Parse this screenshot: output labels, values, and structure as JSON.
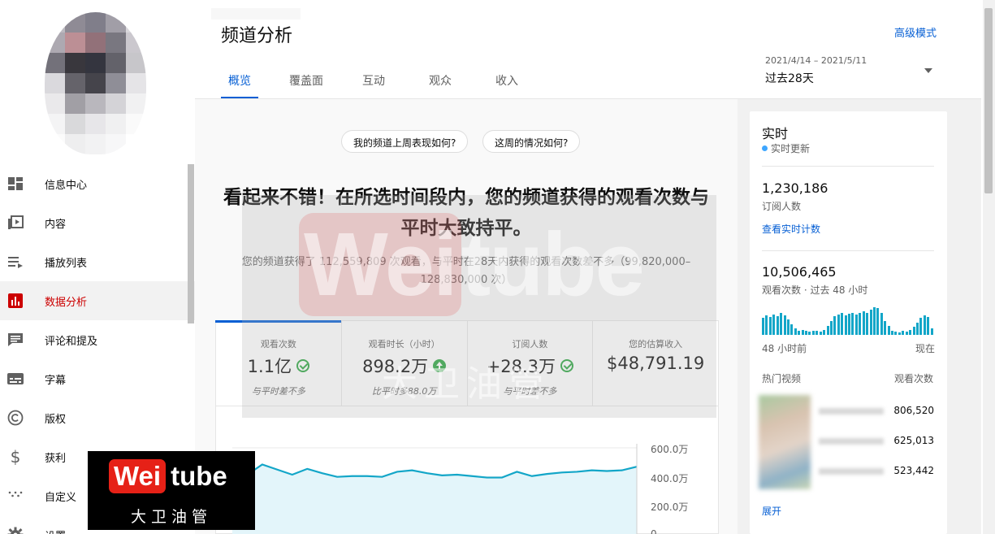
{
  "sidebar": {
    "items": [
      {
        "label": "信息中心",
        "icon": "dashboard-icon"
      },
      {
        "label": "内容",
        "icon": "video-library-icon"
      },
      {
        "label": "播放列表",
        "icon": "playlist-icon"
      },
      {
        "label": "数据分析",
        "icon": "analytics-icon",
        "active": true
      },
      {
        "label": "评论和提及",
        "icon": "comment-icon"
      },
      {
        "label": "字幕",
        "icon": "subtitles-icon"
      },
      {
        "label": "版权",
        "icon": "copyright-icon"
      },
      {
        "label": "获利",
        "icon": "dollar-icon"
      },
      {
        "label": "自定义",
        "icon": "customize-icon"
      },
      {
        "label": "设置",
        "icon": "gear-icon"
      }
    ]
  },
  "header": {
    "title": "频道分析",
    "advanced_mode": "高级模式",
    "tabs": [
      "概览",
      "覆盖面",
      "互动",
      "观众",
      "收入"
    ],
    "date_range": "2021/4/14 – 2021/5/11",
    "period": "过去28天"
  },
  "main": {
    "chips": [
      "我的频道上周表现如何?",
      "这周的情况如何?"
    ],
    "headline": "看起来不错！在所选时间段内，您的频道获得的观看次数与平时大致持平。",
    "subline": "您的频道获得了 112,559,809 次观看，与平时在28天内获得的观看次数差不多（99,820,000–128,830,000 次）",
    "metrics": [
      {
        "label": "观看次数",
        "value": "1.1亿",
        "note": "与平时差不多",
        "status": "ok"
      },
      {
        "label": "观看时长（小时）",
        "value": "898.2万",
        "note": "比平时多88.0万",
        "status": "up"
      },
      {
        "label": "订阅人数",
        "value": "+28.3万",
        "note": "与平时差不多",
        "status": "ok"
      },
      {
        "label": "您的估算收入",
        "value": "$48,791.19",
        "note": "",
        "status": ""
      }
    ]
  },
  "chart_data": {
    "type": "area",
    "y_ticks": [
      "600.0万",
      "400.0万",
      "200.0万",
      "0"
    ],
    "ylim": [
      0,
      6000000
    ],
    "values": [
      4150000,
      4150000,
      4850000,
      4500000,
      4150000,
      4550000,
      4250000,
      4000000,
      4050000,
      4050000,
      4000000,
      4350000,
      4450000,
      4250000,
      4100000,
      4150000,
      4050000,
      3950000,
      3950000,
      4350000,
      4050000,
      4200000,
      4300000,
      4350000,
      4450000,
      4400000,
      4450000,
      4700000
    ]
  },
  "realtime": {
    "title": "实时",
    "live": "实时更新",
    "subscribers": "1,230,186",
    "subscribers_label": "订阅人数",
    "see_live_count": "查看实时计数",
    "views": "10,506,465",
    "views_label": "观看次数 · 过去 48 小时",
    "axis_start": "48 小时前",
    "axis_end": "现在",
    "top_videos_label": "热门视频",
    "views_col_label": "观看次数",
    "top_videos": [
      "806,520",
      "625,013",
      "523,442"
    ],
    "expand": "展开",
    "hourly_views": [
      0.55,
      0.62,
      0.58,
      0.66,
      0.6,
      0.7,
      0.62,
      0.5,
      0.35,
      0.2,
      0.12,
      0.15,
      0.12,
      0.1,
      0.12,
      0.14,
      0.1,
      0.15,
      0.3,
      0.45,
      0.6,
      0.65,
      0.7,
      0.62,
      0.68,
      0.72,
      0.66,
      0.7,
      0.75,
      0.72,
      0.82,
      0.9,
      0.86,
      0.7,
      0.45,
      0.3,
      0.12,
      0.1,
      0.08,
      0.12,
      0.1,
      0.15,
      0.25,
      0.4,
      0.55,
      0.62,
      0.58,
      0.22
    ]
  },
  "brand": {
    "logo_wei": "Wei",
    "logo_tube": "tube",
    "logo_cn": "大卫油管",
    "accent": "#065fd4",
    "red": "#cc0000"
  }
}
